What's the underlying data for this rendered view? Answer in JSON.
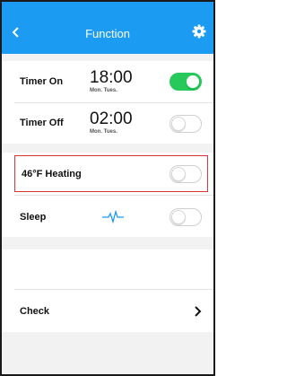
{
  "header": {
    "title": "Function",
    "back_icon": "chevron-left-icon",
    "settings_icon": "gear-icon",
    "color": "#1b9bf2"
  },
  "timers": [
    {
      "label": "Timer On",
      "time": "18:00",
      "days": "Mon. Tues.",
      "enabled": true
    },
    {
      "label": "Timer Off",
      "time": "02:00",
      "days": "Mon. Tues.",
      "enabled": false
    }
  ],
  "heating": {
    "label": "46°F Heating",
    "enabled": false,
    "highlighted": true
  },
  "sleep": {
    "label": "Sleep",
    "icon": "pulse-icon",
    "enabled": false
  },
  "check": {
    "label": "Check",
    "icon": "chevron-right-icon"
  },
  "colors": {
    "toggle_on": "#27c95a",
    "highlight_border": "#d9363e"
  }
}
